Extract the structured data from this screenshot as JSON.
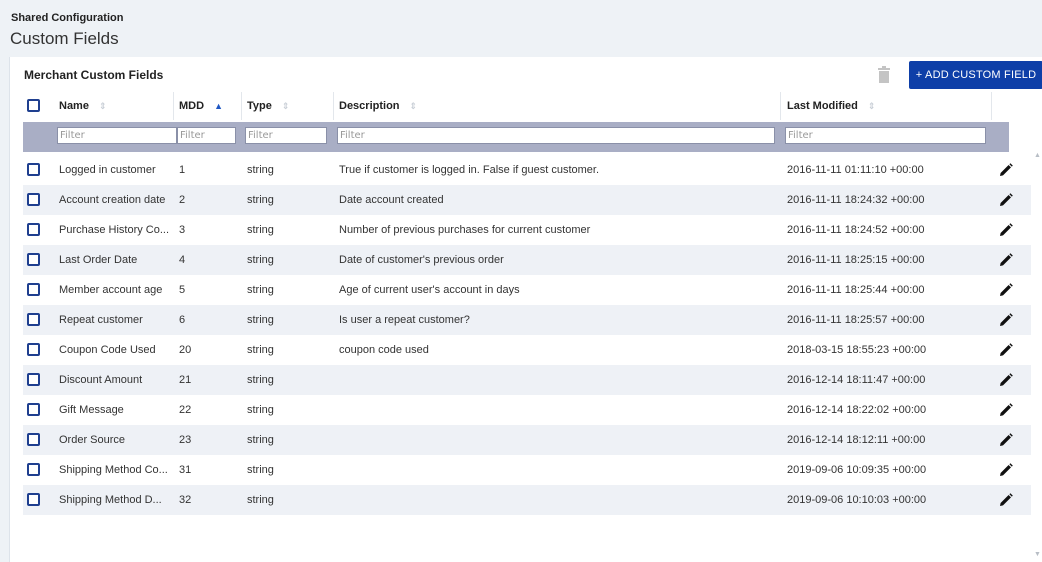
{
  "header": {
    "eyebrow": "Shared Configuration",
    "title": "Custom Fields"
  },
  "panel": {
    "title": "Merchant Custom Fields",
    "add_button": "+ ADD CUSTOM FIELD",
    "delete_icon": "trash-icon"
  },
  "columns": [
    {
      "label": "Name",
      "sort": "none"
    },
    {
      "label": "MDD",
      "sort": "ascending"
    },
    {
      "label": "Type",
      "sort": "none"
    },
    {
      "label": "Description",
      "sort": "none"
    },
    {
      "label": "Last Modified",
      "sort": "none"
    }
  ],
  "filters": {
    "placeholder": "Filter"
  },
  "colors": {
    "accent": "#0e3fa8",
    "filter_bar": "#a9aec5",
    "row_alt": "#eef1f6"
  },
  "rows": [
    {
      "name": "Logged in customer",
      "mdd": "1",
      "type": "string",
      "description": "True if customer is logged in. False if guest customer.",
      "modified": "2016-11-11 01:11:10 +00:00"
    },
    {
      "name": "Account creation date",
      "mdd": "2",
      "type": "string",
      "description": "Date account created",
      "modified": "2016-11-11 18:24:32 +00:00"
    },
    {
      "name": "Purchase History Co...",
      "mdd": "3",
      "type": "string",
      "description": "Number of previous purchases for current customer",
      "modified": "2016-11-11 18:24:52 +00:00"
    },
    {
      "name": "Last Order Date",
      "mdd": "4",
      "type": "string",
      "description": "Date of customer's previous order",
      "modified": "2016-11-11 18:25:15 +00:00"
    },
    {
      "name": "Member account age",
      "mdd": "5",
      "type": "string",
      "description": "Age of current user's account in days",
      "modified": "2016-11-11 18:25:44 +00:00"
    },
    {
      "name": "Repeat customer",
      "mdd": "6",
      "type": "string",
      "description": "Is user a repeat customer?",
      "modified": "2016-11-11 18:25:57 +00:00"
    },
    {
      "name": "Coupon Code Used",
      "mdd": "20",
      "type": "string",
      "description": "coupon code used",
      "modified": "2018-03-15 18:55:23 +00:00"
    },
    {
      "name": "Discount Amount",
      "mdd": "21",
      "type": "string",
      "description": "",
      "modified": "2016-12-14 18:11:47 +00:00"
    },
    {
      "name": "Gift Message",
      "mdd": "22",
      "type": "string",
      "description": "",
      "modified": "2016-12-14 18:22:02 +00:00"
    },
    {
      "name": "Order Source",
      "mdd": "23",
      "type": "string",
      "description": "",
      "modified": "2016-12-14 18:12:11 +00:00"
    },
    {
      "name": "Shipping Method Co...",
      "mdd": "31",
      "type": "string",
      "description": "",
      "modified": "2019-09-06 10:09:35 +00:00"
    },
    {
      "name": "Shipping Method D...",
      "mdd": "32",
      "type": "string",
      "description": "",
      "modified": "2019-09-06 10:10:03 +00:00"
    }
  ]
}
